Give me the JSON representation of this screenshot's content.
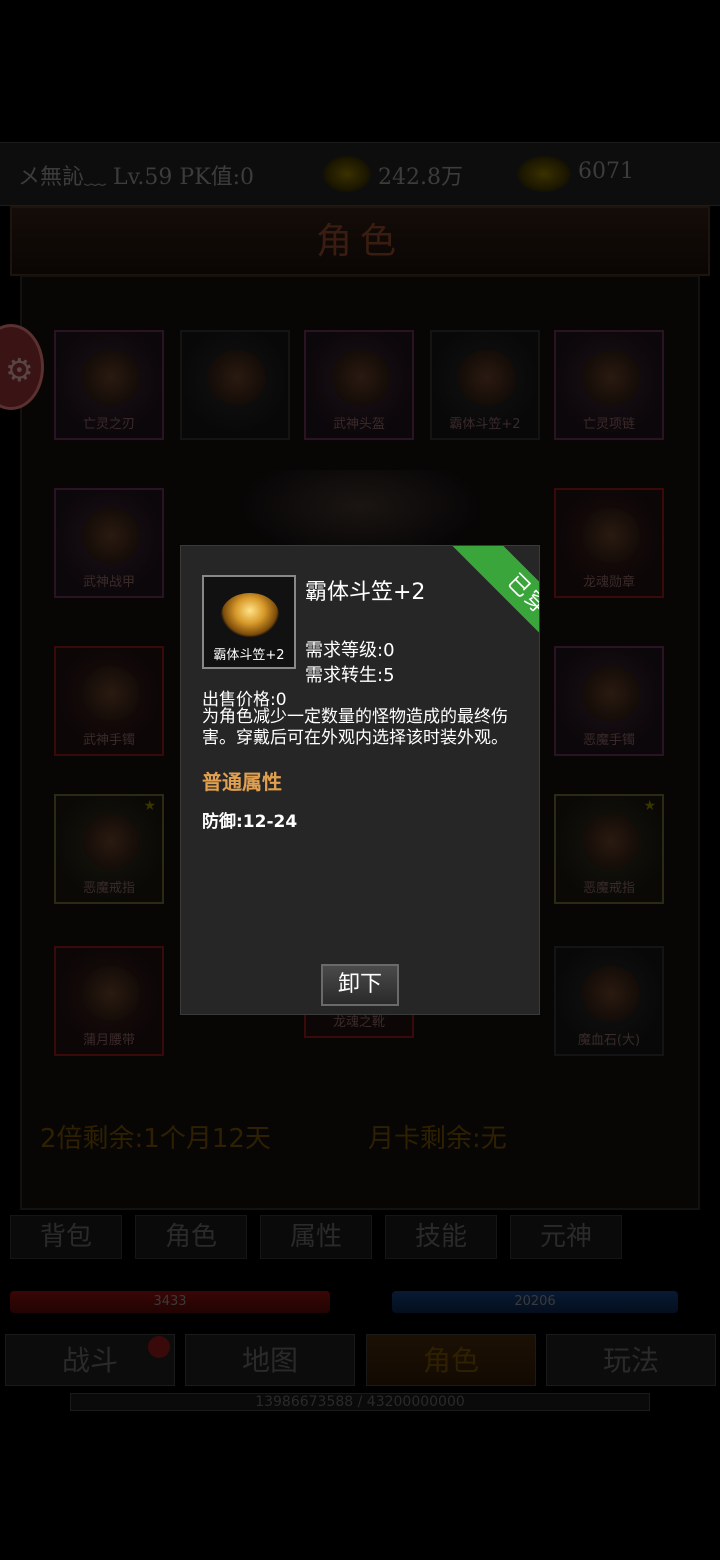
{
  "topbar": {
    "player": "メ無訫﹏ Lv.59 PK值:0",
    "gold": "242.8万",
    "ingot": "6071",
    "gold_icon": "gold-coin-icon",
    "ingot_icon": "gold-ingot-icon"
  },
  "title": "角色",
  "slots": [
    {
      "label": "亡灵之刃"
    },
    {
      "label": ""
    },
    {
      "label": "武神头盔"
    },
    {
      "label": "霸体斗笠+2"
    },
    {
      "label": "亡灵项链"
    },
    {
      "label": "武神战甲"
    },
    {
      "label": "龙魂勋章"
    },
    {
      "label": "武神手镯"
    },
    {
      "label": "恶魔手镯"
    },
    {
      "label": "恶魔戒指"
    },
    {
      "label": "恶魔戒指"
    },
    {
      "label": "蒲月腰带"
    },
    {
      "label": "龙魂之靴"
    },
    {
      "label": "魔血石(大)"
    }
  ],
  "remain": {
    "double": "2倍剩余:1个月12天",
    "card": "月卡剩余:无"
  },
  "tabs": [
    "背包",
    "角色",
    "属性",
    "技能",
    "元神"
  ],
  "bars": {
    "hp": "3433",
    "mp": "20206"
  },
  "nav": [
    "战斗",
    "地图",
    "角色",
    "玩法"
  ],
  "exp": "13986673588 / 43200000000",
  "popup": {
    "ribbon": "已穿戴",
    "icon_caption": "霸体斗笠+2",
    "name": "霸体斗笠+2",
    "req_level": "需求等级:0",
    "req_rebirth": "需求转生:5",
    "price": "出售价格:0",
    "desc": "为角色减少一定数量的怪物造成的最终伤害。穿戴后可在外观内选择该时装外观。",
    "attr_head": "普通属性",
    "defense": "防御:12-24",
    "unequip": "卸下"
  },
  "colors": {
    "ribbon": "#3aa53a",
    "attr_head": "#e0a050"
  }
}
